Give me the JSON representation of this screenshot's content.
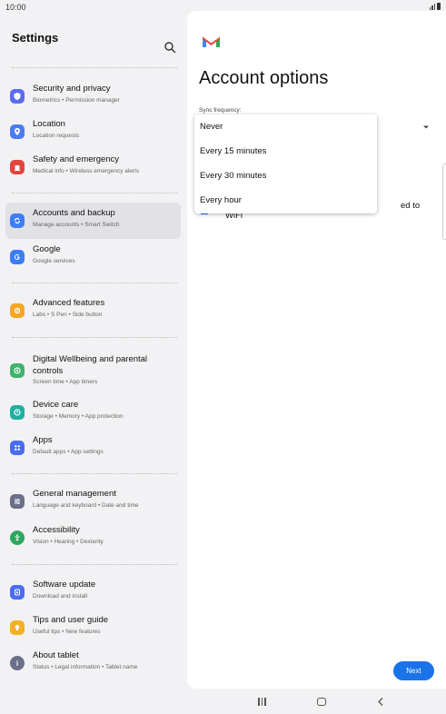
{
  "status_bar": {
    "time": "10:00"
  },
  "left_panel": {
    "title": "Settings",
    "items": [
      {
        "title": "Security and privacy",
        "subtitle": "Biometrics • Permission manager",
        "icon": "shield-icon",
        "color": "#5b6cf0",
        "active": false
      },
      {
        "title": "Location",
        "subtitle": "Location requests",
        "icon": "location-pin-icon",
        "color": "#4a7cf0",
        "active": false
      },
      {
        "title": "Safety and emergency",
        "subtitle": "Medical info • Wireless emergency alerts",
        "icon": "emergency-icon",
        "color": "#e0463f",
        "active": false
      },
      {
        "title": "Accounts and backup",
        "subtitle": "Manage accounts • Smart Switch",
        "icon": "sync-icon",
        "color": "#3d7ef5",
        "active": true
      },
      {
        "title": "Google",
        "subtitle": "Google services",
        "icon": "google-icon",
        "color": "#3d7ef5",
        "active": false
      },
      {
        "title": "Advanced features",
        "subtitle": "Labs • S Pen • Side button",
        "icon": "gear-plus-icon",
        "color": "#f5a623",
        "active": false
      },
      {
        "title": "Digital Wellbeing and parental",
        "title2": "controls",
        "subtitle": "Screen time • App timers",
        "icon": "wellbeing-icon",
        "color": "#3db36b",
        "active": false
      },
      {
        "title": "Device care",
        "subtitle": "Storage • Memory • App protection",
        "icon": "device-care-icon",
        "color": "#1fb0a0",
        "active": false
      },
      {
        "title": "Apps",
        "subtitle": "Default apps • App settings",
        "icon": "apps-grid-icon",
        "color": "#4a6cf0",
        "active": false
      },
      {
        "title": "General management",
        "subtitle": "Language and keyboard • Date and time",
        "icon": "sliders-icon",
        "color": "#6b6f8a",
        "active": false
      },
      {
        "title": "Accessibility",
        "subtitle": "Vision • Hearing • Dexterity",
        "icon": "accessibility-icon",
        "color": "#2ea860",
        "active": false
      },
      {
        "title": "Software update",
        "subtitle": "Download and install",
        "icon": "software-update-icon",
        "color": "#4a6cf0",
        "active": false
      },
      {
        "title": "Tips and user guide",
        "subtitle": "Useful tips • New features",
        "icon": "lightbulb-icon",
        "color": "#f5b025",
        "active": false
      },
      {
        "title": "About tablet",
        "subtitle": "Status • Legal information • Tablet name",
        "icon": "info-icon",
        "color": "#6b6f8a",
        "active": false
      }
    ]
  },
  "right_panel": {
    "title": "Account options",
    "sync_label": "Sync frequency:",
    "behind_text": "ed to",
    "behind_wifi": "WiFi",
    "dropdown_options": [
      "Never",
      "Every 15 minutes",
      "Every 30 minutes",
      "Every hour"
    ],
    "next_label": "Next"
  },
  "colors": {
    "accent": "#1a73e8",
    "panel_bg": "#f2f2f4",
    "active_bg": "#e2e2e6"
  }
}
